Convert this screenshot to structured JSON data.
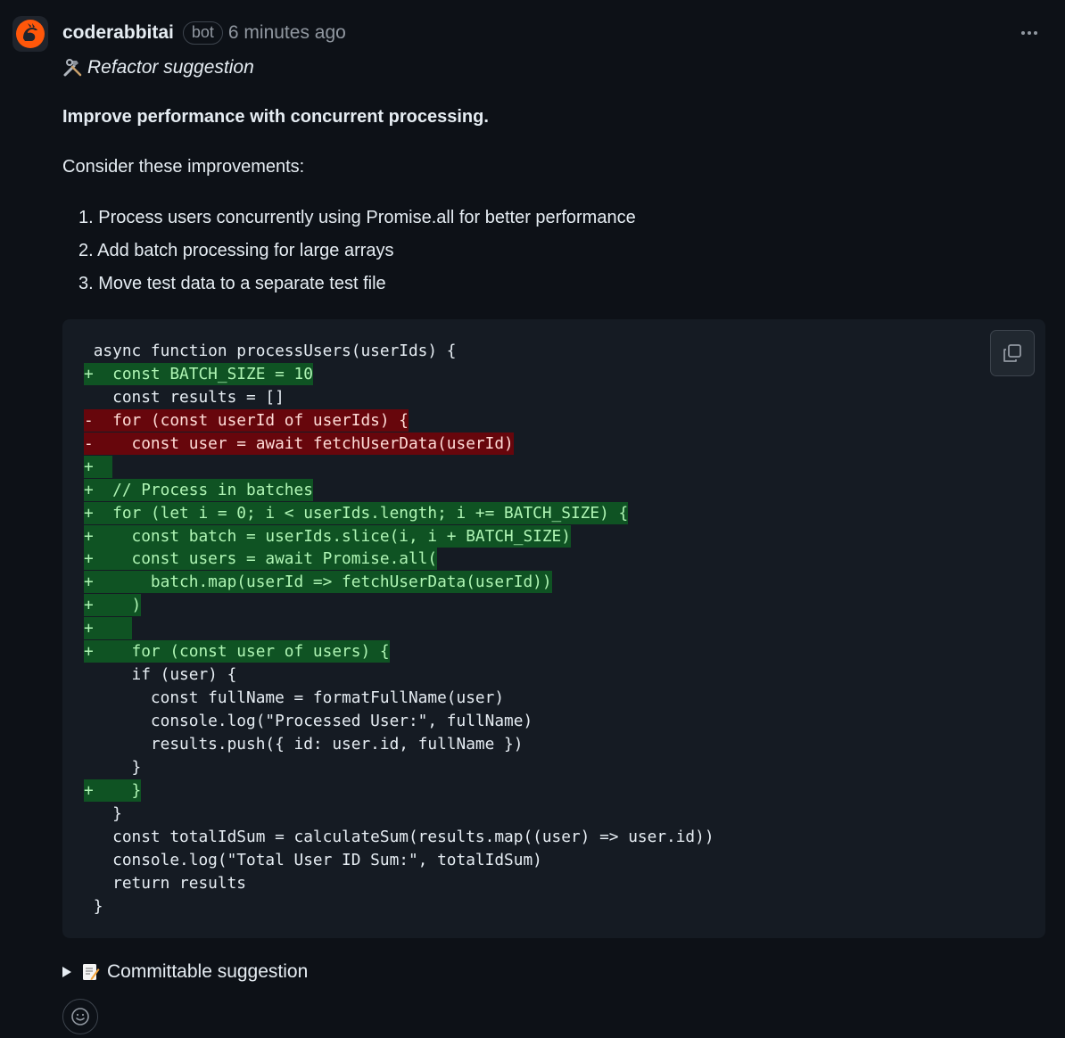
{
  "comment": {
    "author": "coderabbitai",
    "badge": "bot",
    "timestamp": "6 minutes ago",
    "subtitle": "Refactor suggestion",
    "heading": "Improve performance with concurrent processing.",
    "intro": "Consider these improvements:",
    "steps": [
      "1. Process users concurrently using Promise.all for better performance",
      "2. Add batch processing for large arrays",
      "3. Move test data to a separate test file"
    ],
    "details_label": "Committable suggestion"
  },
  "icons": {
    "avatar": "coderabbit-logo-icon",
    "menu": "kebab-menu-icon",
    "subtitle": "hammer-wrench-icon",
    "copy": "copy-icon",
    "expand": "triangle-right-icon",
    "memo": "memo-icon",
    "reaction": "smiley-icon"
  },
  "colors": {
    "background": "#0d1117",
    "code_background": "#151b23",
    "added_background": "#0f5323",
    "added_text": "#aff5b4",
    "removed_background": "#67060c",
    "removed_text": "#ffdcd7",
    "muted_text": "#9198a1",
    "brand_orange": "#ff570a"
  },
  "code_lines": [
    {
      "type": "ctx",
      "text": " async function processUsers(userIds) {"
    },
    {
      "type": "add",
      "text": "+  const BATCH_SIZE = 10"
    },
    {
      "type": "ctx",
      "text": "   const results = []"
    },
    {
      "type": "del",
      "text": "-  for (const userId of userIds) {"
    },
    {
      "type": "del",
      "text": "-    const user = await fetchUserData(userId)"
    },
    {
      "type": "add",
      "text": "+  "
    },
    {
      "type": "add",
      "text": "+  // Process in batches"
    },
    {
      "type": "add",
      "text": "+  for (let i = 0; i < userIds.length; i += BATCH_SIZE) {"
    },
    {
      "type": "add",
      "text": "+    const batch = userIds.slice(i, i + BATCH_SIZE)"
    },
    {
      "type": "add",
      "text": "+    const users = await Promise.all("
    },
    {
      "type": "add",
      "text": "+      batch.map(userId => fetchUserData(userId))"
    },
    {
      "type": "add",
      "text": "+    )"
    },
    {
      "type": "add",
      "text": "+    "
    },
    {
      "type": "add",
      "text": "+    for (const user of users) {"
    },
    {
      "type": "ctx",
      "text": "     if (user) {"
    },
    {
      "type": "ctx",
      "text": "       const fullName = formatFullName(user)"
    },
    {
      "type": "ctx",
      "text": "       console.log(\"Processed User:\", fullName)"
    },
    {
      "type": "ctx",
      "text": "       results.push({ id: user.id, fullName })"
    },
    {
      "type": "ctx",
      "text": "     }"
    },
    {
      "type": "add",
      "text": "+    }"
    },
    {
      "type": "ctx",
      "text": "   }"
    },
    {
      "type": "ctx",
      "text": "   const totalIdSum = calculateSum(results.map((user) => user.id))"
    },
    {
      "type": "ctx",
      "text": "   console.log(\"Total User ID Sum:\", totalIdSum)"
    },
    {
      "type": "ctx",
      "text": "   return results"
    },
    {
      "type": "ctx",
      "text": " }"
    }
  ]
}
